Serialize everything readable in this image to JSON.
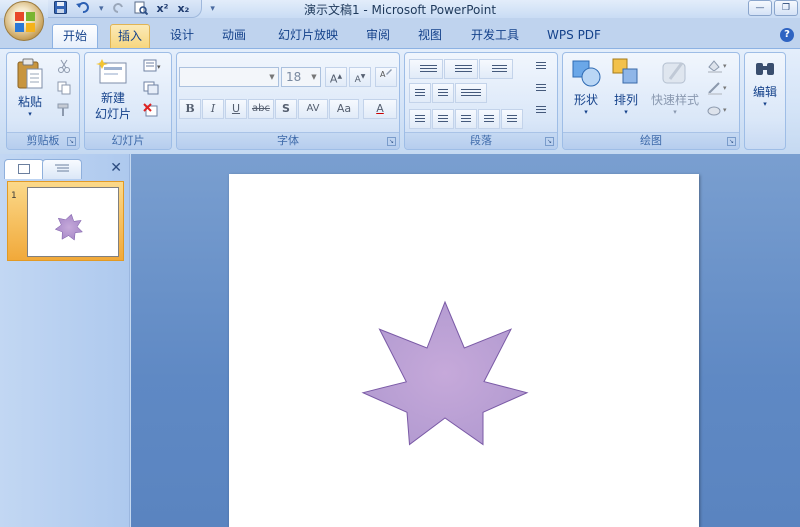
{
  "window": {
    "title": "演示文稿1 - Microsoft PowerPoint"
  },
  "qat": {
    "superscript_label": "x²",
    "subscript_label": "x₂"
  },
  "tabs": [
    {
      "label": "开始",
      "state": "active"
    },
    {
      "label": "插入",
      "state": "hover"
    },
    {
      "label": "设计",
      "state": "normal"
    },
    {
      "label": "动画",
      "state": "normal"
    },
    {
      "label": "幻灯片放映",
      "state": "normal"
    },
    {
      "label": "审阅",
      "state": "normal"
    },
    {
      "label": "视图",
      "state": "normal"
    },
    {
      "label": "开发工具",
      "state": "normal"
    },
    {
      "label": "WPS PDF",
      "state": "normal"
    }
  ],
  "groups": {
    "clipboard": {
      "label": "剪贴板",
      "paste": "粘贴"
    },
    "slides": {
      "label": "幻灯片",
      "new_slide_line1": "新建",
      "new_slide_line2": "幻灯片"
    },
    "font": {
      "label": "字体",
      "font_name": "",
      "font_size": "18"
    },
    "paragraph": {
      "label": "段落"
    },
    "drawing": {
      "label": "绘图",
      "shapes": "形状",
      "arrange": "排列",
      "quick_styles": "快速样式"
    },
    "editing": {
      "label": "编辑"
    }
  },
  "font_buttons": {
    "bold": "B",
    "italic": "I",
    "underline": "U",
    "strike": "abc",
    "shadow": "S",
    "spacing": "AV",
    "case": "Aa",
    "color": "A",
    "grow": "A",
    "shrink": "A"
  },
  "pane": {
    "slide_number": "1"
  },
  "colors": {
    "star_fill_center": "#c6a9da",
    "star_fill_edge": "#b39bd1",
    "star_stroke": "#7a5aa6",
    "accent": "#15428b"
  }
}
